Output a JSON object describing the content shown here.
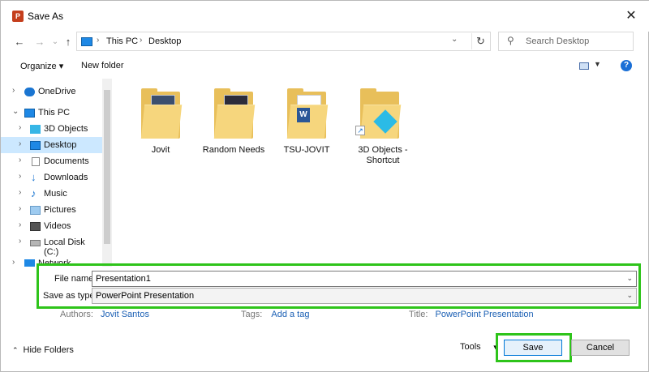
{
  "window": {
    "title": "Save As",
    "app_icon_letter": "P",
    "close_glyph": "✕"
  },
  "nav": {
    "back_glyph": "←",
    "forward_glyph": "→",
    "recent_glyph": "⌄",
    "up_glyph": "↑",
    "breadcrumb": [
      "This PC",
      "Desktop"
    ],
    "crumb_sep": "›",
    "search_placeholder": "Search Desktop",
    "refresh_glyph": "↻",
    "dropdown_glyph": "⌄"
  },
  "toolbar": {
    "organize": "Organize ▾",
    "new_folder": "New folder",
    "help": "?",
    "view_drop": "▼"
  },
  "tree": [
    {
      "label": "OneDrive",
      "chev": "›",
      "icon": "cloud-icon"
    },
    {
      "label": "This PC",
      "chev": "⌄",
      "icon": "pc-icon"
    },
    {
      "label": "3D Objects",
      "chev": "›",
      "icon": "cube-icon"
    },
    {
      "label": "Desktop",
      "chev": "›",
      "icon": "desktop-icon",
      "selected": true
    },
    {
      "label": "Documents",
      "chev": "›",
      "icon": "document-icon"
    },
    {
      "label": "Downloads",
      "chev": "›",
      "icon": "download-icon"
    },
    {
      "label": "Music",
      "chev": "›",
      "icon": "music-icon"
    },
    {
      "label": "Pictures",
      "chev": "›",
      "icon": "pictures-icon"
    },
    {
      "label": "Videos",
      "chev": "›",
      "icon": "video-icon"
    },
    {
      "label": "Local Disk (C:)",
      "chev": "›",
      "icon": "disk-icon"
    },
    {
      "label": "Network",
      "chev": "›",
      "icon": "network-icon"
    }
  ],
  "files": [
    {
      "name": "Jovit",
      "type": "folder"
    },
    {
      "name": "Random Needs",
      "type": "folder"
    },
    {
      "name": "TSU-JOVIT",
      "type": "folder"
    },
    {
      "name": "3D Objects - Shortcut",
      "type": "shortcut"
    }
  ],
  "form": {
    "file_name_label": "File name:",
    "file_name_value": "Presentation1",
    "save_type_label": "Save as type:",
    "save_type_value": "PowerPoint Presentation",
    "arrow": "⌄"
  },
  "meta": {
    "authors_label": "Authors:",
    "authors_value": "Jovit Santos",
    "tags_label": "Tags:",
    "tags_value": "Add a tag",
    "title_label": "Title:",
    "title_value": "PowerPoint Presentation"
  },
  "footer": {
    "hide_folders": "Hide Folders",
    "hide_caret": "⌃",
    "tools": "Tools",
    "tools_caret": "▼",
    "save": "Save",
    "cancel": "Cancel"
  },
  "colors": {
    "highlight": "#2ec41a",
    "link": "#1a5fb4",
    "selected_bg": "#cce8ff"
  }
}
